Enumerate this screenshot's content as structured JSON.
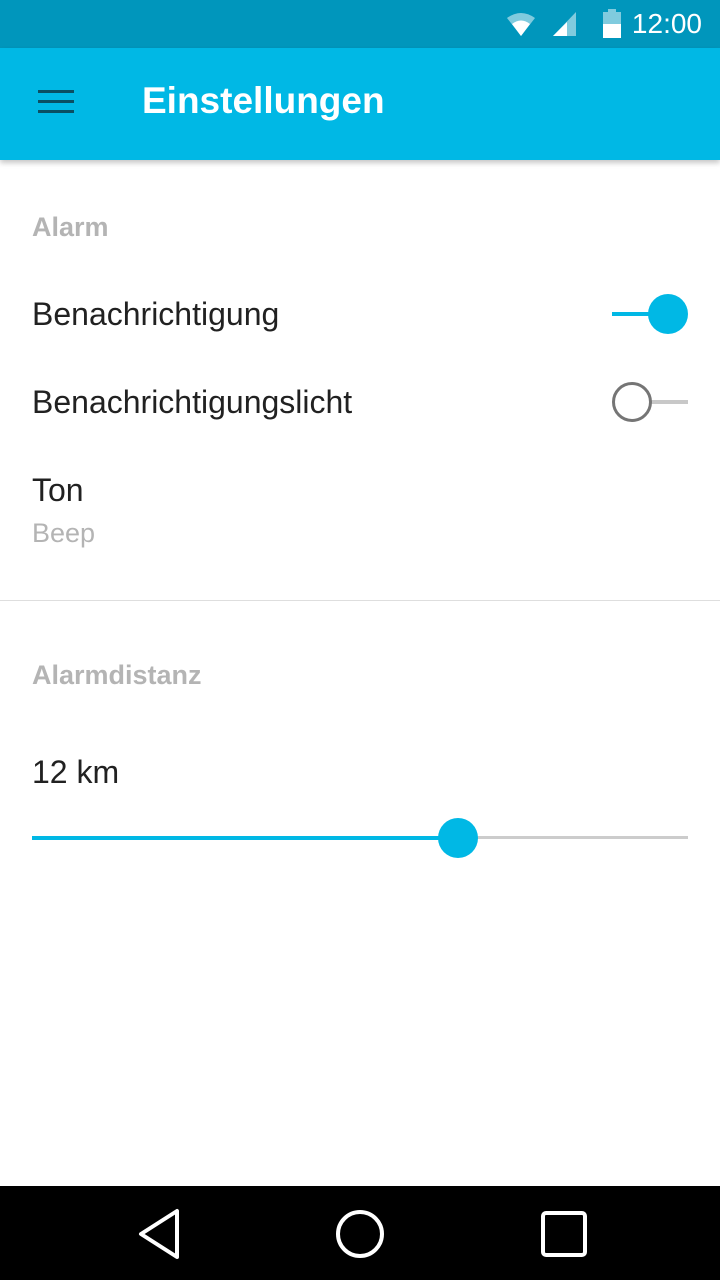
{
  "status_bar": {
    "time": "12:00",
    "icons": [
      "wifi-icon",
      "cell-signal-icon",
      "battery-icon"
    ]
  },
  "app_bar": {
    "menu_icon": "hamburger-menu-icon",
    "title": "Einstellungen",
    "color": "#00b8e5"
  },
  "sections": {
    "alarm": {
      "header": "Alarm",
      "notification": {
        "label": "Benachrichtigung",
        "enabled": true
      },
      "notification_light": {
        "label": "Benachrichtigungslicht",
        "enabled": false
      },
      "sound": {
        "label": "Ton",
        "value": "Beep"
      }
    },
    "distance": {
      "header": "Alarmdistanz",
      "value_label": "12 km",
      "slider_fraction": 0.65
    }
  },
  "nav_bar": {
    "icons": [
      "back-icon",
      "home-icon",
      "recents-icon"
    ]
  },
  "colors": {
    "accent": "#00b8e5",
    "status_bar": "#0096bc",
    "secondary_text": "#b4b4b4"
  }
}
